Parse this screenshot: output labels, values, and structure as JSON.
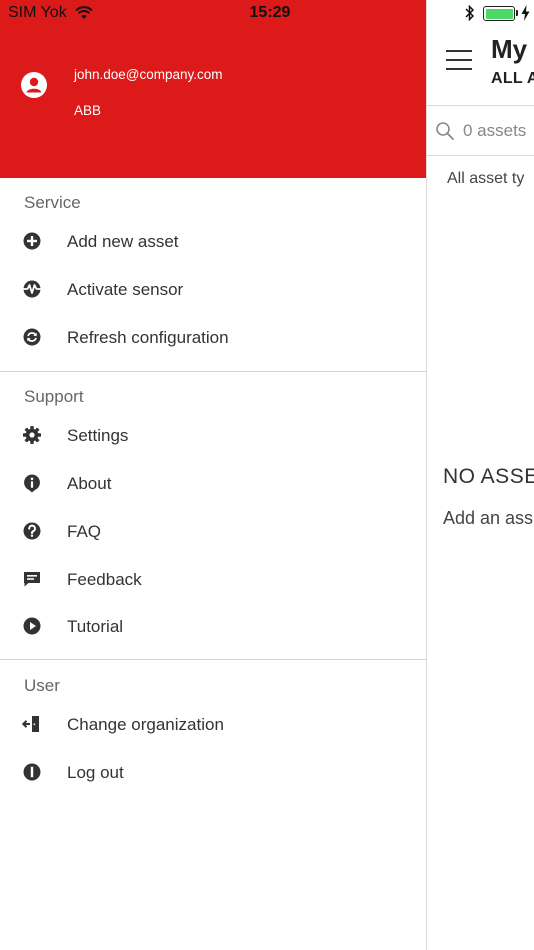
{
  "status_bar": {
    "carrier": "SIM Yok",
    "time": "15:29"
  },
  "drawer": {
    "header": {
      "email": "john.doe@company.com",
      "organization": "ABB",
      "background_color": "#dc1a1a"
    },
    "sections": [
      {
        "title": "Service",
        "items": [
          {
            "label": "Add new asset",
            "icon": "plus-circle-icon"
          },
          {
            "label": "Activate sensor",
            "icon": "pulse-icon"
          },
          {
            "label": "Refresh configuration",
            "icon": "refresh-icon"
          }
        ]
      },
      {
        "title": "Support",
        "items": [
          {
            "label": "Settings",
            "icon": "gear-icon"
          },
          {
            "label": "About",
            "icon": "info-marker-icon"
          },
          {
            "label": "FAQ",
            "icon": "question-icon"
          },
          {
            "label": "Feedback",
            "icon": "chat-icon"
          },
          {
            "label": "Tutorial",
            "icon": "play-icon"
          }
        ]
      },
      {
        "title": "User",
        "items": [
          {
            "label": "Change organization",
            "icon": "door-exit-icon"
          },
          {
            "label": "Log out",
            "icon": "alert-circle-icon"
          }
        ]
      }
    ]
  },
  "main": {
    "title": "My (",
    "subtitle": "ALL A",
    "search_count": "0 assets",
    "filter_label": "All asset ty",
    "empty_title": "NO ASSE",
    "empty_text": "Add an ass"
  }
}
